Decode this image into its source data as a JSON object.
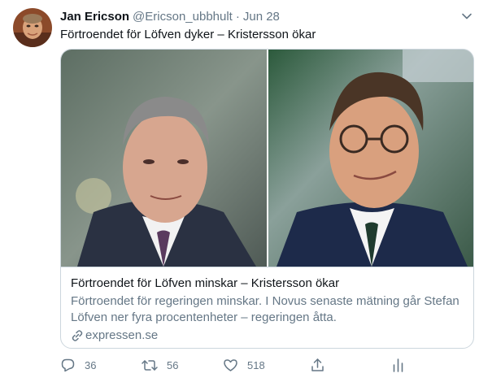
{
  "tweet": {
    "author": {
      "display_name": "Jan Ericson",
      "handle": "@Ericson_ubbhult",
      "separator": "·",
      "date": "Jun 28"
    },
    "text": "Förtroendet för Löfven dyker – Kristersson ökar",
    "card": {
      "title": "Förtroendet för Löfven minskar – Kristersson ökar",
      "description": "Förtroendet för regeringen minskar. I Novus senaste mätning går Stefan Löfven ner fyra procentenheter – regeringen åtta.",
      "source": "expressen.se"
    },
    "actions": {
      "reply": {
        "icon": "reply-icon",
        "count": "36"
      },
      "retweet": {
        "icon": "retweet-icon",
        "count": "56"
      },
      "like": {
        "icon": "heart-icon",
        "count": "518"
      },
      "share": {
        "icon": "share-icon"
      },
      "analytics": {
        "icon": "analytics-icon"
      }
    },
    "colors": {
      "text": "#0f1419",
      "secondary": "#657786",
      "border": "#ccd6dd"
    }
  }
}
